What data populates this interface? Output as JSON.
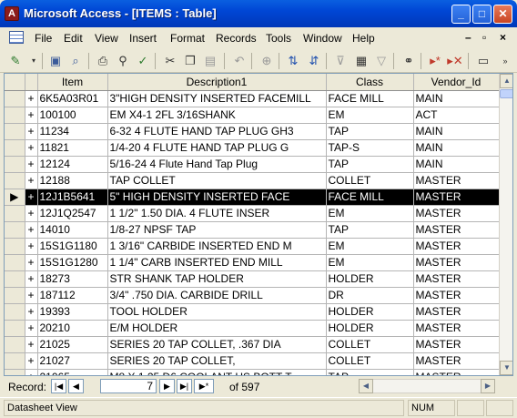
{
  "window": {
    "title": "Microsoft Access - [ITEMS : Table]",
    "app_icon": "A"
  },
  "menu": {
    "items": [
      "File",
      "Edit",
      "View",
      "Insert",
      "Format",
      "Records",
      "Tools",
      "Window",
      "Help"
    ]
  },
  "table": {
    "columns": [
      "Item",
      "Description1",
      "Class",
      "Vendor_Id"
    ],
    "current_row": 6,
    "rows": [
      [
        "6K5A03R01",
        "3\"HIGH DENSITY INSERTED FACEMILL",
        "FACE MILL",
        "MAIN"
      ],
      [
        "100100",
        "EM X4-1 2FL 3/16SHANK",
        "EM",
        "ACT"
      ],
      [
        "11234",
        "6-32 4 FLUTE HAND TAP PLUG GH3",
        "TAP",
        "MAIN"
      ],
      [
        "11821",
        "1/4-20 4 FLUTE HAND TAP PLUG G",
        "TAP-S",
        "MAIN"
      ],
      [
        "12124",
        "5/16-24 4 Flute Hand Tap Plug",
        "TAP",
        "MAIN"
      ],
      [
        "12188",
        "TAP COLLET",
        "COLLET",
        "MASTER"
      ],
      [
        "12J1B5641",
        "5\" HIGH DENSITY INSERTED FACE",
        "FACE MILL",
        "MASTER"
      ],
      [
        "12J1Q2547",
        "1 1/2\" 1.50 DIA. 4 FLUTE INSER",
        "EM",
        "MASTER"
      ],
      [
        "14010",
        "1/8-27 NPSF TAP",
        "TAP",
        "MASTER"
      ],
      [
        "15S1G1180",
        "1 3/16\" CARBIDE INSERTED END M",
        "EM",
        "MASTER"
      ],
      [
        "15S1G1280",
        "1 1/4\" CARB INSERTED END MILL",
        "EM",
        "MASTER"
      ],
      [
        "18273",
        "STR SHANK TAP HOLDER",
        "HOLDER",
        "MASTER"
      ],
      [
        "187112",
        "3/4\" .750 DIA. CARBIDE DRILL",
        "DR",
        "MASTER"
      ],
      [
        "19393",
        "TOOL HOLDER",
        "HOLDER",
        "MASTER"
      ],
      [
        "20210",
        "E/M HOLDER",
        "HOLDER",
        "MASTER"
      ],
      [
        "21025",
        "SERIES 20 TAP COLLET, .367 DIA",
        "COLLET",
        "MASTER"
      ],
      [
        "21027",
        "SERIES 20 TAP COLLET,",
        "COLLET",
        "MASTER"
      ],
      [
        "21065",
        "M8 X 1.25 D6 COOLANT HS BOTT T",
        "TAP",
        "MASTER"
      ]
    ]
  },
  "navigator": {
    "label": "Record:",
    "current": "7",
    "of_text": "of 597"
  },
  "status": {
    "left": "Datasheet View",
    "num": "NUM"
  }
}
